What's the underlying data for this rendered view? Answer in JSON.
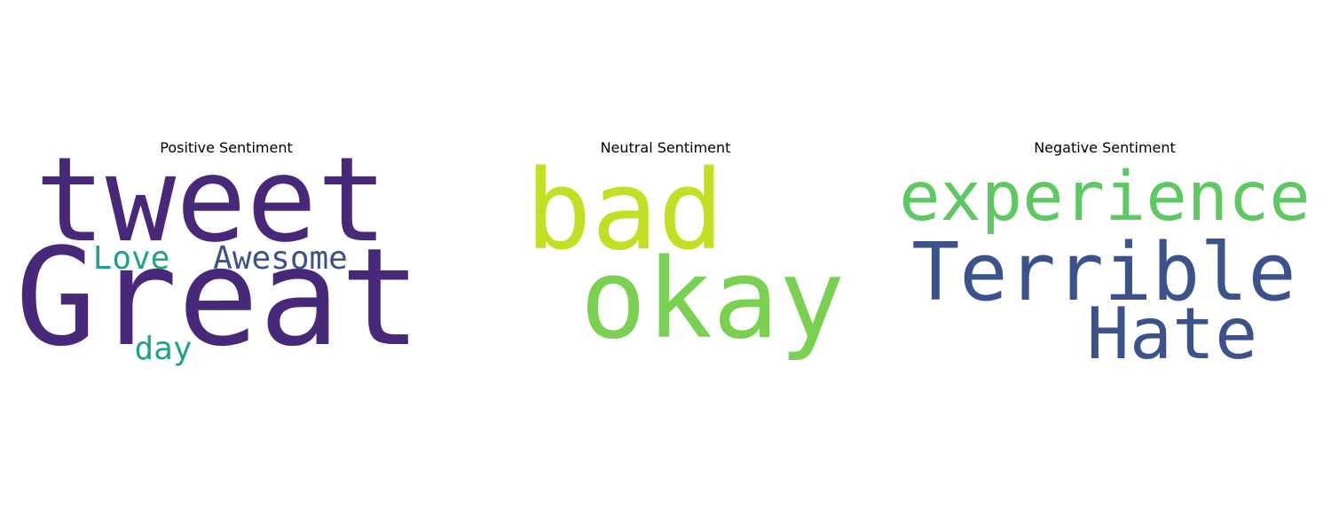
{
  "chart_data": {
    "type": "wordcloud",
    "panels": [
      {
        "title": "Positive Sentiment",
        "words": [
          {
            "text": "tweet",
            "color": "#482878"
          },
          {
            "text": "Great",
            "color": "#482878"
          },
          {
            "text": "Love",
            "color": "#21a08a"
          },
          {
            "text": "Awesome",
            "color": "#3b528b"
          },
          {
            "text": "day",
            "color": "#21a08a"
          }
        ]
      },
      {
        "title": "Neutral Sentiment",
        "words": [
          {
            "text": "bad",
            "color": "#c2df23"
          },
          {
            "text": "okay",
            "color": "#7ad151"
          }
        ]
      },
      {
        "title": "Negative Sentiment",
        "words": [
          {
            "text": "experience",
            "color": "#5ec962"
          },
          {
            "text": "Terrible",
            "color": "#3b528b"
          },
          {
            "text": "Hate",
            "color": "#3b528b"
          }
        ]
      }
    ]
  }
}
